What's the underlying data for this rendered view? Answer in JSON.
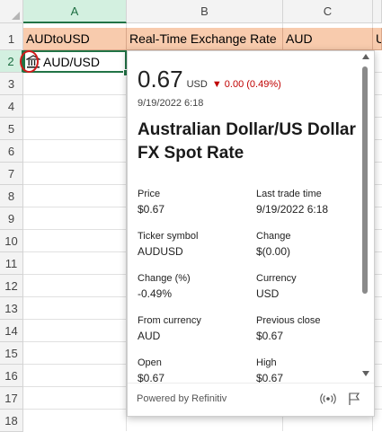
{
  "columns": [
    "A",
    "B",
    "C",
    ""
  ],
  "rows": [
    "1",
    "2",
    "3",
    "4",
    "5",
    "6",
    "7",
    "8",
    "9",
    "10",
    "11",
    "12",
    "13",
    "14",
    "15",
    "16",
    "17",
    "18"
  ],
  "header_row": {
    "a1": "AUDtoUSD",
    "b1": "Real-Time Exchange Rate",
    "c1": "AUD",
    "d1": "U"
  },
  "a2": {
    "icon": "bank-icon",
    "text": "AUD/USD"
  },
  "card": {
    "price": "0.67",
    "currency_code": "USD",
    "change_arrow": "▼",
    "change_text": "0.00 (0.49%)",
    "timestamp": "9/19/2022 6:18",
    "title": "Australian Dollar/US Dollar FX Spot Rate",
    "fields": [
      {
        "label": "Price",
        "value": "$0.67"
      },
      {
        "label": "Last trade time",
        "value": "9/19/2022 6:18"
      },
      {
        "label": "Ticker symbol",
        "value": "AUDUSD"
      },
      {
        "label": "Change",
        "value": "$(0.00)"
      },
      {
        "label": "Change (%)",
        "value": "-0.49%"
      },
      {
        "label": "Currency",
        "value": "USD"
      },
      {
        "label": "From currency",
        "value": "AUD"
      },
      {
        "label": "Previous close",
        "value": "$0.67"
      },
      {
        "label": "Open",
        "value": "$0.67"
      },
      {
        "label": "High",
        "value": "$0.67"
      }
    ],
    "footer": "Powered by Refinitiv",
    "footer_icons": [
      "broadcast-icon",
      "flag-icon"
    ]
  },
  "colors": {
    "header_fill": "#f8cbad",
    "selection": "#217346",
    "negative": "#c00000",
    "annotation": "#d11b1b"
  }
}
